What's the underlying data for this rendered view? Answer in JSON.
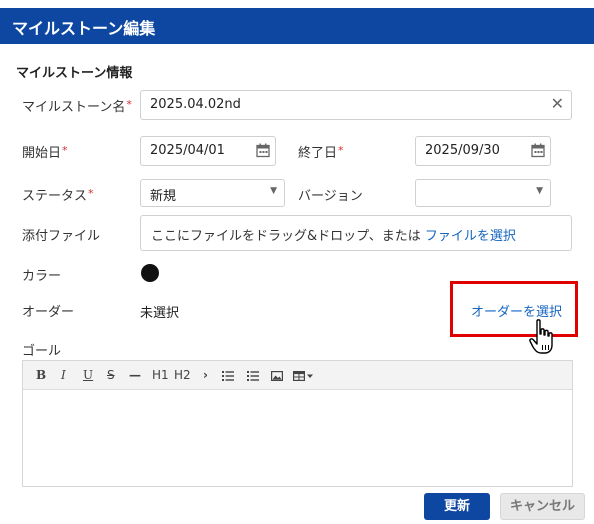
{
  "dialog": {
    "title": "マイルストーン編集"
  },
  "section": {
    "title": "マイルストーン情報"
  },
  "form": {
    "name": {
      "label": "マイルストーン名",
      "required_mark": "*",
      "value": "2025.04.02nd"
    },
    "start_date": {
      "label": "開始日",
      "required_mark": "*",
      "value": "2025/04/01"
    },
    "end_date": {
      "label": "終了日",
      "required_mark": "*",
      "value": "2025/09/30"
    },
    "status": {
      "label": "ステータス",
      "required_mark": "*",
      "value": "新規"
    },
    "version": {
      "label": "バージョン",
      "value": ""
    },
    "attachment": {
      "label": "添付ファイル",
      "drop_text": "ここにファイルをドラッグ&ドロップ、または ",
      "select_link": "ファイルを選択"
    },
    "color": {
      "label": "カラー",
      "value": "#111111"
    },
    "order": {
      "label": "オーダー",
      "value": "未選択",
      "select_link": "オーダーを選択"
    },
    "goal": {
      "label": "ゴール"
    }
  },
  "editor_toolbar": [
    "B",
    "I",
    "U",
    "S",
    "—",
    "H1",
    "H2",
    "›",
    "bullet-list-icon",
    "numbered-list-icon",
    "image-icon",
    "table-icon"
  ],
  "buttons": {
    "update": "更新",
    "cancel": "キャンセル"
  },
  "colors": {
    "header": "#0d47a1",
    "link": "#1565c0",
    "required": "#d32f2f",
    "highlight": "#e00000"
  }
}
